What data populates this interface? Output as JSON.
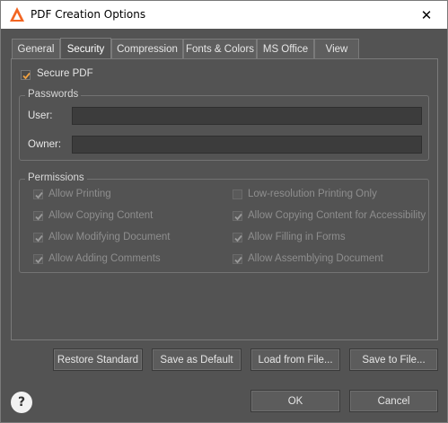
{
  "window": {
    "title": "PDF Creation Options",
    "close_glyph": "✕",
    "app_icon": "adobe-acrobat-icon",
    "accent": "#f26522"
  },
  "tabs": [
    {
      "label": "General",
      "active": false
    },
    {
      "label": "Security",
      "active": true
    },
    {
      "label": "Compression",
      "active": false
    },
    {
      "label": "Fonts & Colors",
      "active": false
    },
    {
      "label": "MS Office",
      "active": false
    },
    {
      "label": "View",
      "active": false
    }
  ],
  "security": {
    "secure_pdf": {
      "label": "Secure PDF",
      "checked": true
    },
    "passwords": {
      "title": "Passwords",
      "user_label": "User:",
      "user_value": "",
      "owner_label": "Owner:",
      "owner_value": ""
    },
    "permissions": {
      "title": "Permissions",
      "items": [
        {
          "label": "Allow Printing",
          "checked": true
        },
        {
          "label": "Low-resolution Printing Only",
          "checked": false
        },
        {
          "label": "Allow Copying Content",
          "checked": true
        },
        {
          "label": "Allow Copying Content for Accessibility",
          "checked": true
        },
        {
          "label": "Allow Modifying Document",
          "checked": true
        },
        {
          "label": "Allow Filling in Forms",
          "checked": true
        },
        {
          "label": "Allow Adding Comments",
          "checked": true
        },
        {
          "label": "Allow Assemblying Document",
          "checked": true
        }
      ]
    }
  },
  "buttons": {
    "restore": "Restore Standard",
    "save_default": "Save as Default",
    "load_file": "Load from File...",
    "save_file": "Save to File...",
    "ok": "OK",
    "cancel": "Cancel",
    "help": "?"
  }
}
